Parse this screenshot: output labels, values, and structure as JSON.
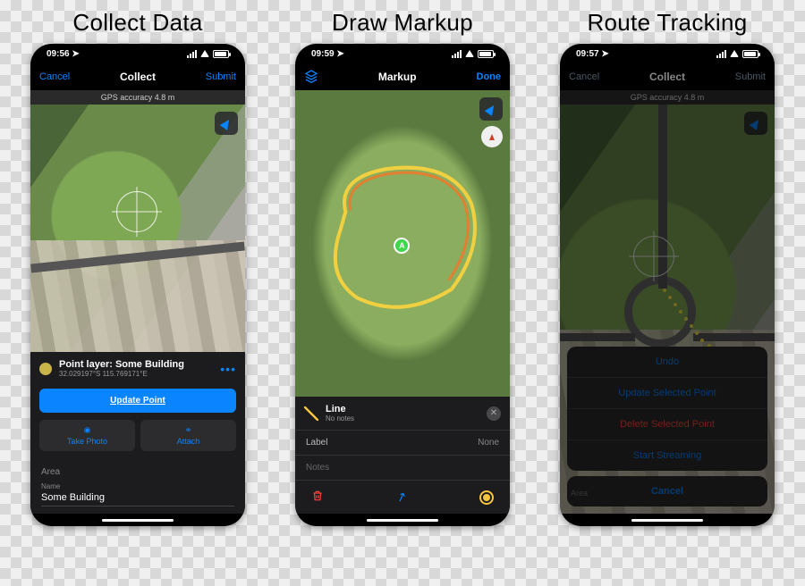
{
  "columns": {
    "collect": {
      "title": "Collect Data"
    },
    "markup": {
      "title": "Draw Markup"
    },
    "route": {
      "title": "Route Tracking"
    }
  },
  "status": {
    "collect_time": "09:56",
    "markup_time": "09:59",
    "route_time": "09:57",
    "location_arrow": "➤"
  },
  "collect": {
    "nav": {
      "cancel": "Cancel",
      "title": "Collect",
      "submit": "Submit"
    },
    "gps": "GPS accuracy 4.8 m",
    "panel": {
      "header": "Point layer: Some Building",
      "coords": "32.029197°S 115.769171°E",
      "update_btn": "Update Point",
      "take_photo": "Take Photo",
      "attach": "Attach",
      "area_label": "Area",
      "name_label": "Name",
      "name_value": "Some Building"
    }
  },
  "markup": {
    "nav": {
      "title": "Markup",
      "done": "Done"
    },
    "panel": {
      "header": "Line",
      "sub": "No notes",
      "label_field": "Label",
      "label_value": "None",
      "notes_field": "Notes"
    },
    "marker_text": "A"
  },
  "route": {
    "nav": {
      "cancel": "Cancel",
      "title": "Collect",
      "submit": "Submit"
    },
    "gps": "GPS accuracy 4.8 m",
    "area_label": "Area",
    "actions": {
      "undo": "Undo",
      "update": "Update Selected Point",
      "delete": "Delete Selected Point",
      "stream": "Start Streaming",
      "cancel": "Cancel"
    }
  }
}
